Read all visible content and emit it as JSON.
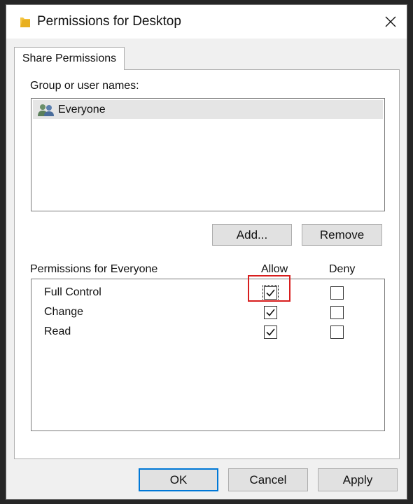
{
  "window": {
    "title": "Permissions for Desktop",
    "icon": "folder-icon",
    "close_icon": "close-icon"
  },
  "tabs": [
    {
      "label": "Share Permissions",
      "selected": true
    }
  ],
  "group_section": {
    "label": "Group or user names:",
    "items": [
      {
        "label": "Everyone",
        "icon": "user-group-icon",
        "selected": true
      }
    ]
  },
  "buttons": {
    "add": "Add...",
    "remove": "Remove"
  },
  "permissions": {
    "label": "Permissions for Everyone",
    "allow_header": "Allow",
    "deny_header": "Deny",
    "rows": [
      {
        "name": "Full Control",
        "allow": true,
        "deny": false,
        "focused": true
      },
      {
        "name": "Change",
        "allow": true,
        "deny": false
      },
      {
        "name": "Read",
        "allow": true,
        "deny": false
      }
    ]
  },
  "footer": {
    "ok": "OK",
    "cancel": "Cancel",
    "apply": "Apply"
  },
  "colors": {
    "highlight": "#d81e1e",
    "default_button_border": "#0078d7",
    "folder_yellow": "#f5c542"
  }
}
